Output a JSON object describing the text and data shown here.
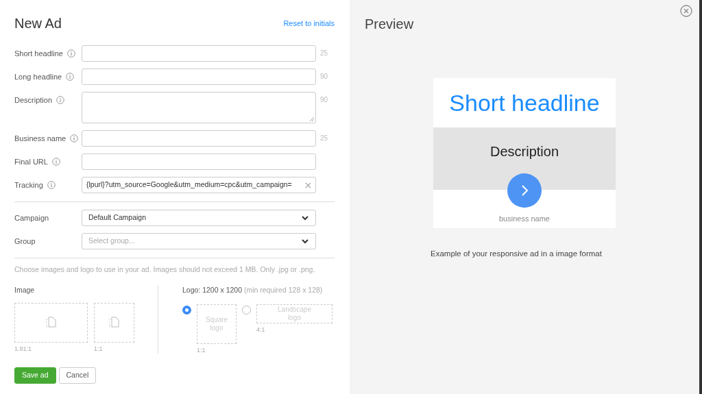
{
  "form": {
    "title": "New Ad",
    "reset_link": "Reset to initials",
    "fields": [
      {
        "label": "Short headline",
        "kind": "text",
        "counter": "25"
      },
      {
        "label": "Long headline",
        "kind": "text",
        "counter": "90"
      },
      {
        "label": "Description",
        "kind": "textarea",
        "counter": "90"
      },
      {
        "label": "Business name",
        "kind": "text",
        "counter": "25"
      },
      {
        "label": "Final URL",
        "kind": "text"
      },
      {
        "label": "Tracking",
        "kind": "text",
        "value": "{lpurl}?utm_source=Google&utm_medium=cpc&utm_campaign="
      }
    ],
    "selects": [
      {
        "label": "Campaign",
        "value": "Default Campaign"
      },
      {
        "label": "Group",
        "placeholder": "Select group..."
      }
    ],
    "images_hint": "Choose images and logo to use in your ad. Images should not exceed 1 MB. Only .jpg or .png.",
    "image": {
      "label": "Image",
      "slots": [
        {
          "ratio": "1.91:1"
        },
        {
          "ratio": "1:1"
        }
      ]
    },
    "logo": {
      "label": "Logo: 1200 x 1200",
      "note": "(min required 128 x 128)",
      "options": [
        {
          "label": "Square logo",
          "ratio": "1:1",
          "selected": true
        },
        {
          "label": "Landscape logo",
          "ratio": "4:1",
          "selected": false
        }
      ]
    },
    "buttons": [
      {
        "label": "Save ad",
        "kind": "primary"
      },
      {
        "label": "Cancel",
        "kind": "secondary"
      }
    ]
  },
  "preview": {
    "title": "Preview",
    "headline": "Short headline",
    "description": "Description",
    "business_name": "business name",
    "caption": "Example of your responsive ad in a image format"
  }
}
